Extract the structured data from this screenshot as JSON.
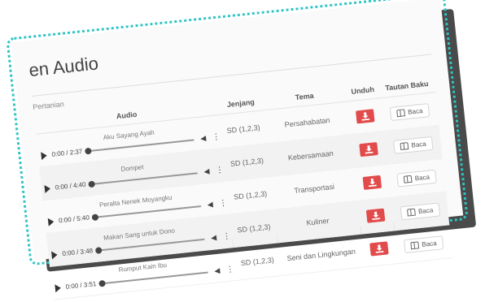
{
  "page": {
    "title_fragment": "en Audio",
    "filter_label": "Pertanian"
  },
  "table": {
    "headers": {
      "audio": "Audio",
      "jenjang": "Jenjang",
      "tema": "Tema",
      "unduh": "Unduh",
      "tautan_baku": "Tautan Baku"
    },
    "rows": [
      {
        "audio_title": "Aku Sayang Ayah",
        "time": "0:00 / 2:37",
        "jenjang": "SD (1,2,3)",
        "tema": "Persahabatan",
        "baca_label": "Baca"
      },
      {
        "audio_title": "Dompet",
        "time": "0:00 / 4:40",
        "jenjang": "SD (1,2,3)",
        "tema": "Kebersamaan",
        "baca_label": "Baca"
      },
      {
        "audio_title": "Peralta Nenek Moyangku",
        "time": "0:00 / 5:40",
        "jenjang": "SD (1,2,3)",
        "tema": "Transportasi",
        "baca_label": "Baca"
      },
      {
        "audio_title": "Makan Sang untuk Dono",
        "time": "0:00 / 3:48",
        "jenjang": "SD (1,2,3)",
        "tema": "Kuliner",
        "baca_label": "Baca"
      },
      {
        "audio_title": "Rumput Kain Ibu",
        "time": "0:00 / 3:51",
        "jenjang": "SD (1,2,3)",
        "tema": "Seni dan Lingkungan",
        "baca_label": "Baca"
      }
    ]
  },
  "icons": {
    "play": "play-icon",
    "volume": "volume-icon",
    "menu": "kebab-menu-icon",
    "download": "download-icon",
    "book": "book-icon"
  },
  "colors": {
    "accent_border": "#2fc4c4",
    "download_button": "#e24b4b",
    "shadow": "#4a4a4a"
  }
}
